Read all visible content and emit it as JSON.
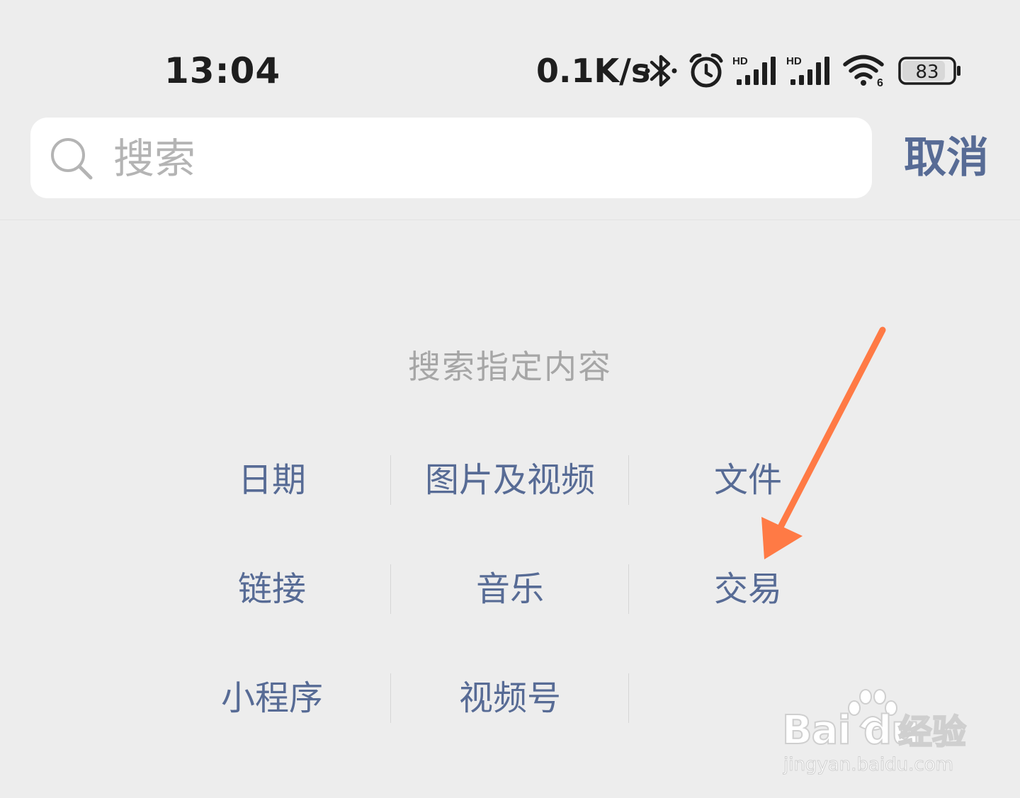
{
  "status_bar": {
    "time": "13:04",
    "net_speed": "0.1K/s",
    "battery": "83",
    "signal1_tag": "HD",
    "signal2_tag": "HD",
    "wifi_tag": "6",
    "icons": [
      "bluetooth-icon",
      "alarm-icon",
      "signal-icon",
      "signal-icon",
      "wifi-icon",
      "battery-icon"
    ]
  },
  "search": {
    "placeholder": "搜索",
    "cancel_label": "取消"
  },
  "section": {
    "title": "搜索指定内容"
  },
  "categories": [
    [
      "日期",
      "图片及视频",
      "文件"
    ],
    [
      "链接",
      "音乐",
      "交易"
    ],
    [
      "小程序",
      "视频号"
    ]
  ],
  "annotation": {
    "arrow_color": "#ff7a45"
  },
  "watermark": {
    "brand": "Bai du",
    "cn": "经验",
    "url": "jingyan.baidu.com"
  }
}
